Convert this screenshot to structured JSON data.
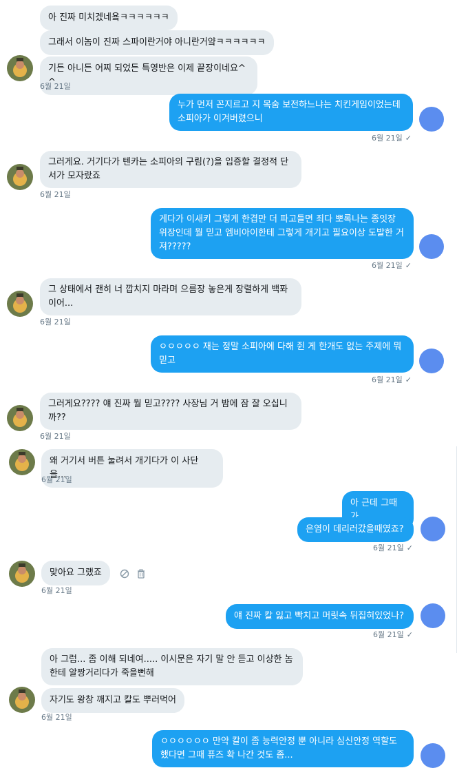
{
  "colors": {
    "incoming_bubble": "#e6ecf0",
    "outgoing_bubble": "#1da1f2",
    "timestamp": "#657786",
    "avatar_out": "#5b8def"
  },
  "messages": [
    {
      "id": "m1",
      "dir": "in",
      "text": "아 진짜 미치겠네욬ㅋㅋㅋㅋㅋㅋ"
    },
    {
      "id": "m2",
      "dir": "in",
      "text": "그래서 이놈이 진짜 스파이란거야 아니란거얔ㅋㅋㅋㅋㅋㅋ"
    },
    {
      "id": "m3",
      "dir": "in",
      "text": "기든 아니든 어찌 되었든 특영반은 이제 끝장이네요^^",
      "time": "6월 21일"
    },
    {
      "id": "m4",
      "dir": "out",
      "text": "누가 먼저 꼰지르고 지 목숨 보전하느냐는 치킨게임이었는데 소피아가 이겨버렸으니",
      "time": "6월 21일"
    },
    {
      "id": "m5",
      "dir": "in",
      "text": "그러게요. 거기다가 텐카는 소피아의 구림(?)을 입증할 결정적 단서가 모자랐죠",
      "time": "6월 21일"
    },
    {
      "id": "m6",
      "dir": "out",
      "text": "게다가 이새키 그렇게 한겹만 더 파고들면 죄다 뽀록나는 종잇장 위장인데 뭘 믿고 엠비아이한테 그렇게 개기고 필요이상 도발한 거져?????",
      "time": "6월 21일"
    },
    {
      "id": "m7",
      "dir": "in",
      "text": "그 상태에서 괜히 너 깝치지 마라며 으름장 놓은게 장렬하게 백퐈 이어...",
      "time": "6월 21일"
    },
    {
      "id": "m8",
      "dir": "out",
      "text": "ㅇㅇㅇㅇㅇ 재는 정말 소피아에 다해 쥔 게 한개도 없는 주제에 뭐 믿고",
      "time": "6월 21일"
    },
    {
      "id": "m9",
      "dir": "in",
      "text": "그러게요???? 얘 진짜 뭘 믿고???? 사장님 거 밤에 잠 잘 오십니까??",
      "time": "6월 21일"
    },
    {
      "id": "m10",
      "dir": "in",
      "text": "왜 거기서 버튼 눌려서 개기다가 이 사단을...",
      "time": "6월 21일"
    },
    {
      "id": "m11",
      "dir": "out",
      "text": "아 근데 그때가"
    },
    {
      "id": "m12",
      "dir": "out",
      "text": "은염이 데리러갔을때였죠?",
      "time": "6월 21일"
    },
    {
      "id": "m13",
      "dir": "in",
      "text": "맞아요 그랬죠",
      "time": "6월 21일"
    },
    {
      "id": "m14",
      "dir": "out",
      "text": "얘 진짜 칼 잃고 빡치고 머릿속 뒤집혀있었나?",
      "time": "6월 21일"
    },
    {
      "id": "m15",
      "dir": "in",
      "text": "아 그럼... 좀 이해 되네여..... 이시문은 자기 말 안 듣고 이상한 놈한테 알짱거리다가 죽을뻔해"
    },
    {
      "id": "m16",
      "dir": "in",
      "text": "자기도 왕창 깨지고 칼도 뿌러먹어",
      "time": "6월 21일"
    },
    {
      "id": "m17",
      "dir": "out",
      "text": "ㅇㅇㅇㅇㅇㅇ 만약 칼이 좀 능력안정 뿐 아니라 심신안정 역할도 했다면 그때 퓨즈 확 나간 것도 좀..."
    }
  ],
  "icons": {
    "read_receipt": "✓",
    "block": "block-icon",
    "trash": "trash-icon"
  }
}
